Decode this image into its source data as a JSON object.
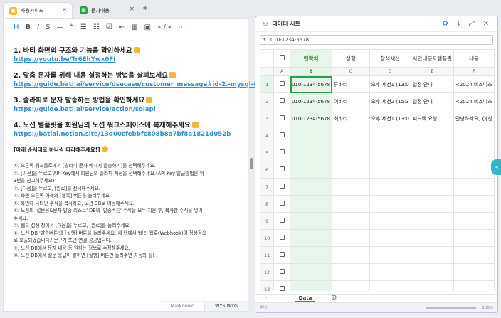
{
  "tabs": [
    {
      "label": "사용가이드",
      "icon_color": "#f0c020",
      "active": true
    },
    {
      "label": "문자내용",
      "icon_color": "#2e9e47",
      "active": false
    }
  ],
  "toolbar": {
    "items": [
      "H",
      "B",
      "I",
      "S",
      "—",
      "❝",
      "☰",
      "☷",
      "☑",
      "⇤",
      "▦",
      "▣",
      "</>",
      "⋯"
    ]
  },
  "guide": {
    "steps": [
      {
        "title": "1. 바티 화면의 구조와 기능을 확인하세요",
        "link": "https://youtu.be/Tr6EhYwx0FI"
      },
      {
        "title": "2. 맞춤 문자를 위해 내용 설정하는 방법을 살펴보세요",
        "link": "https://guide.bati.ai/service/usecase/customer_message#id-2.-mysql-db"
      },
      {
        "title": "3. 솔라피로 문자 발송하는 방법을 확인하세요",
        "link": "https://guide.bati.ai/service/action/solapi"
      },
      {
        "title": "4. 노션 템플릿을 회원님의 노션 워크스페이스에 복제해주세요",
        "link": "https://batiai.notion.site/13d00cfebbfc808b8a7bf8a1821d052b"
      }
    ],
    "instr_title": "[아래 순서대로 하나씩 따라해주세요!]",
    "instructions": [
      "①. 오른쪽 워크플로에서 [솔라피 문자 메시지 발송하기]를 선택해주세요.",
      "②. [이전]을 누르고 API Key에서 회원님의 솔라피 계정을 선택해주세요.(API Key 발급방법은 위",
      "3번을 참고해주세요)",
      "③. [다음]을 누르고, [완료]를 선택해주세요.",
      "④. 화면 오른쪽 아래의 [웹훅] 버튼을 눌러주세요.",
      "⑤. 화면에 나타난 수식을 복사하고, 노션 DB로 이동해주세요.",
      "⑥. 노션의 '설문용&문자 발송 리스트' DB의 '발송버튼' 수식을 모두 지운 후, 복사한 수식을 넣어",
      "주세요.",
      "⑦. 웹훅 설정 창에서 [다음]을 누르고, [완료]를 눌러주세요.",
      "⑧. 노션 DB '발송버튼'의 [실행] 버튼을 눌러주세요. 새 탭에서 '바티 웹훅(Webhook)이 정상적으",
      "로 호출되었습니다.' 문구가 뜨면 연결 성공입니다.",
      "⑨. 노션 DB에서 문자 내용 등 원하는 정보로 수정해주세요.",
      "⑩. 노션 DB에서 설문 응답이 쌓이면 [실행] 버튼만 눌러주면 자동화 끝!"
    ]
  },
  "mode": {
    "markdown": "Markdown",
    "wysiwyg": "WYSIWYG"
  },
  "sheet": {
    "title": "데이터 시트",
    "formula_value": "010-1234-5678",
    "headers": [
      "연락처",
      "성함",
      "참석세션",
      "사안내문자템플릿",
      "내용"
    ],
    "letters": [
      "A",
      "B",
      "C",
      "D",
      "E",
      "F"
    ],
    "rows": [
      {
        "n": "1",
        "cells": [
          "010-1234-5678",
          "류바티",
          "오후 세션1 (13:0",
          "일정 안내",
          "<2024 비즈니스"
        ]
      },
      {
        "n": "2",
        "cells": [
          "010-1234-5678",
          "이바티",
          "오후 세션2 (15:3",
          "일정 안내",
          "<2024 비즈니스"
        ]
      },
      {
        "n": "3",
        "cells": [
          "010-1234-5678",
          "최바티",
          "오후 세션1 (13:0",
          "피드백 요청",
          "안녕하세요, {{성"
        ]
      },
      {
        "n": "4",
        "cells": [
          "",
          "",
          "",
          "",
          ""
        ]
      },
      {
        "n": "5",
        "cells": [
          "",
          "",
          "",
          "",
          ""
        ]
      },
      {
        "n": "6",
        "cells": [
          "",
          "",
          "",
          "",
          ""
        ]
      },
      {
        "n": "7",
        "cells": [
          "",
          "",
          "",
          "",
          ""
        ]
      },
      {
        "n": "8",
        "cells": [
          "",
          "",
          "",
          "",
          ""
        ]
      },
      {
        "n": "9",
        "cells": [
          "",
          "",
          "",
          "",
          ""
        ]
      },
      {
        "n": "10",
        "cells": [
          "",
          "",
          "",
          "",
          ""
        ]
      },
      {
        "n": "11",
        "cells": [
          "",
          "",
          "",
          "",
          ""
        ]
      },
      {
        "n": "12",
        "cells": [
          "",
          "",
          "",
          "",
          ""
        ]
      },
      {
        "n": "13",
        "cells": [
          "",
          "",
          "",
          "",
          ""
        ]
      }
    ],
    "sheet_tab": "Data",
    "status_left": "준비",
    "zoom": "100%"
  }
}
